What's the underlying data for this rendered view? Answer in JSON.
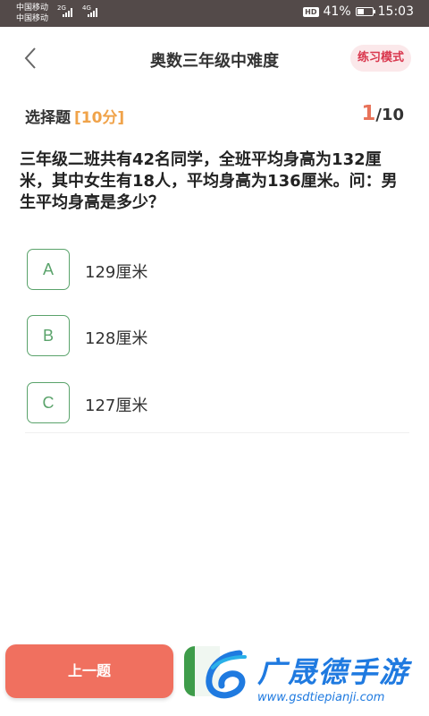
{
  "status_bar": {
    "carrier1": "中国移动",
    "carrier2": "中国移动",
    "net1": "2G",
    "net2": "4G",
    "hd": "HD",
    "battery": "41%",
    "battery_level": 0.41,
    "time": "15:03"
  },
  "header": {
    "title": "奥数三年级中难度",
    "mode_label": "练习模式"
  },
  "question_meta": {
    "type": "选择题",
    "score": "[10分]",
    "current": "1",
    "total": "/10"
  },
  "question": {
    "text": "三年级二班共有42名同学，全班平均身高为132厘米，其中女生有18人，平均身高为136厘米。问：男生平均身高是多少？"
  },
  "options": [
    {
      "letter": "A",
      "text": "129厘米"
    },
    {
      "letter": "B",
      "text": "128厘米"
    },
    {
      "letter": "C",
      "text": "127厘米"
    }
  ],
  "bottom": {
    "prev_label": "上一题"
  },
  "watermark": {
    "name": "广晟德手游",
    "url": "www.gsdtiepianji.com"
  },
  "colors": {
    "status_bg": "#534a49",
    "accent_green": "#5aa36b",
    "mode_red": "#d9364d",
    "score_orange": "#f0a34a",
    "prev_button": "#f0705f"
  }
}
